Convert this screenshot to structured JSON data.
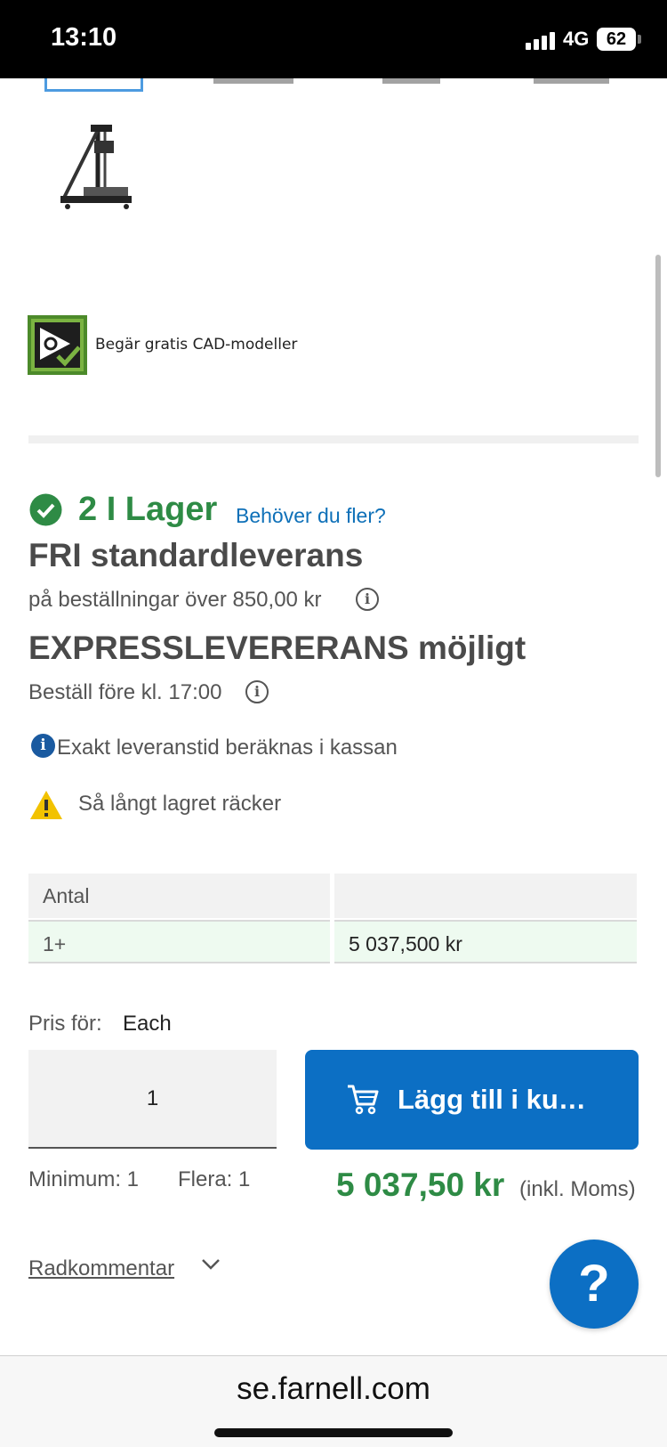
{
  "status_bar": {
    "time": "13:10",
    "network": "4G",
    "battery": "62"
  },
  "gallery": {
    "selected_thumb_icon": "thumbnail-selected",
    "product_image_icon": "3d-printer-icon"
  },
  "cad": {
    "icon": "cad-model-icon",
    "label": "Begär gratis CAD-modeller"
  },
  "stock": {
    "icon": "check-circle-icon",
    "text": "2 I Lager",
    "link": "Behöver du fler?",
    "color": "#2e8b45"
  },
  "delivery": {
    "free_title": "FRI standardleverans",
    "free_sub": "på beställningar över 850,00 kr",
    "express_title": "EXPRESSLEVERERANS möjligt",
    "express_sub": "Beställ före kl. 17:00",
    "info_note": "Exakt leveranstid beräknas i kassan",
    "warning": "Så långt lagret räcker"
  },
  "price_table": {
    "headers": [
      "Antal",
      ""
    ],
    "rows": [
      {
        "qty": "1+",
        "price": "5 037,500 kr"
      }
    ]
  },
  "purchase": {
    "price_for_label": "Pris för:",
    "price_for_value": "Each",
    "quantity_value": "1",
    "add_button": "Lägg till i ku…",
    "minimum": "Minimum: 1",
    "multiple": "Flera: 1",
    "total": "5 037,50 kr",
    "total_note": "(inkl. Moms)",
    "accent_color": "#0c6fc4"
  },
  "row_comment": {
    "label": "Radkommentar"
  },
  "help": {
    "label": "?"
  },
  "browser": {
    "url": "se.farnell.com"
  }
}
